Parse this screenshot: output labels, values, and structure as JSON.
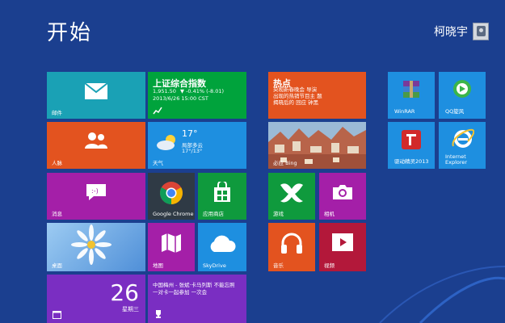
{
  "header": {
    "title": "开始",
    "user_name": "柯晓宇"
  },
  "colors": {
    "background": "#1b3f8f"
  },
  "tiles": {
    "mail": {
      "label": "邮件",
      "icon": "envelope-icon",
      "color": "#1aa1b5"
    },
    "stock": {
      "label": "上证综合指数",
      "value": "1,951.50",
      "change": "▼ -0.41% (-8.01)",
      "datetime": "2013/6/26 15:00 CST",
      "icon": "stock-trend-icon",
      "color": "#00a33c"
    },
    "people": {
      "label": "人脉",
      "icon": "people-icon",
      "color": "#e3531f"
    },
    "weather": {
      "label": "天气",
      "temp": "17°",
      "location": "局部多云",
      "range": "17°/13°",
      "icon": "cloud-sun-icon",
      "color": "#1e8fe0"
    },
    "messaging": {
      "label": "消息",
      "icon": "chat-icon",
      "color": "#a41fa8"
    },
    "chrome": {
      "label": "Google Chrome",
      "icon": "chrome-icon",
      "color": "#2f3a45"
    },
    "store": {
      "label": "应用商店",
      "icon": "store-icon",
      "color": "#0f9a3d"
    },
    "desktop": {
      "label": "桌面",
      "icon": "daisy-wallpaper",
      "color": "#6aa9e4"
    },
    "maps": {
      "label": "地图",
      "icon": "map-icon",
      "color": "#a41fa8"
    },
    "skydrive": {
      "label": "SkyDrive",
      "icon": "cloud-icon",
      "color": "#1e8fe0"
    },
    "calendar": {
      "day_number": "26",
      "weekday": "星期三",
      "icon": "calendar-icon",
      "color": "#7a2ec2"
    },
    "message_news": {
      "line1": "中国梅州 - 张斌·卡马列斯 不能忘照",
      "line2": "一对卡一起参加 一次会",
      "icon": "trophy-icon",
      "color": "#7a2ec2"
    },
    "news": {
      "title": "热点",
      "line1": "央视新春晚会 导演",
      "line2": "出现的热销节目主 题",
      "line3": "揭晓后的 回应 钟黑",
      "icon": "news-icon",
      "color": "#e3531f"
    },
    "bing": {
      "label": "必应 Bing",
      "icon": "bing-photo",
      "color": "#b8644a"
    },
    "games": {
      "label": "游戏",
      "icon": "xbox-icon",
      "color": "#0f9a3d"
    },
    "camera": {
      "label": "相机",
      "icon": "camera-icon",
      "color": "#a41fa8"
    },
    "music": {
      "label": "音乐",
      "icon": "headphones-icon",
      "color": "#e3531f"
    },
    "video": {
      "label": "视频",
      "icon": "play-icon",
      "color": "#b3183a"
    },
    "winrar": {
      "label": "WinRAR",
      "icon": "winrar-icon",
      "color": "#1e8fe0"
    },
    "qq": {
      "label": "QQ旋风",
      "icon": "qq-whirlwind-icon",
      "color": "#1e8fe0"
    },
    "driver": {
      "label": "驱动精灵2013",
      "icon": "driver-genius-icon",
      "color": "#1e8fe0"
    },
    "ie": {
      "label": "Internet Explorer",
      "icon": "ie-icon",
      "color": "#1e8fe0"
    }
  }
}
